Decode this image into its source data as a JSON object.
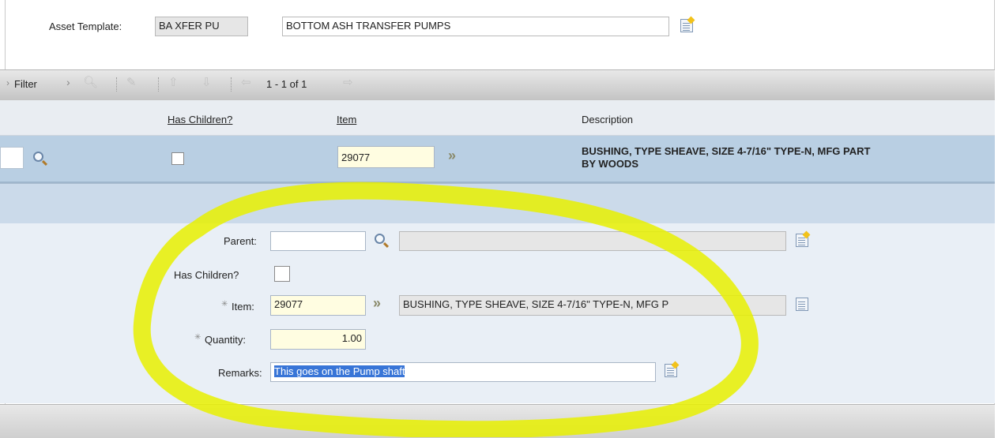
{
  "header": {
    "asset_template_label": "Asset Template:",
    "asset_template_code": "BA XFER PU",
    "asset_template_desc": "BOTTOM ASH TRANSFER PUMPS"
  },
  "toolbar": {
    "filter_label": "Filter",
    "pagination": "1 - 1 of 1"
  },
  "table": {
    "columns": [
      "Has Children?",
      "Item",
      "Description"
    ],
    "rows": [
      {
        "has_children": false,
        "item": "29077",
        "description_line1": "BUSHING, TYPE SHEAVE, SIZE 4-7/16\" TYPE-N, MFG PART",
        "description_line2": "BY WOODS"
      }
    ]
  },
  "detail": {
    "parent_label": "Parent:",
    "parent_value": "",
    "has_children_label": "Has Children?",
    "item_label": "Item:",
    "item_value": "29077",
    "item_desc": "BUSHING, TYPE SHEAVE, SIZE 4-7/16\" TYPE-N, MFG P",
    "quantity_label": "Quantity:",
    "quantity_value": "1.00",
    "remarks_label": "Remarks:",
    "remarks_value": "This goes on the Pump shaft"
  },
  "colors": {
    "selected_row": "#b9cfe3",
    "required_field": "#fffde1",
    "highlight_annotation": "#e8f000"
  }
}
